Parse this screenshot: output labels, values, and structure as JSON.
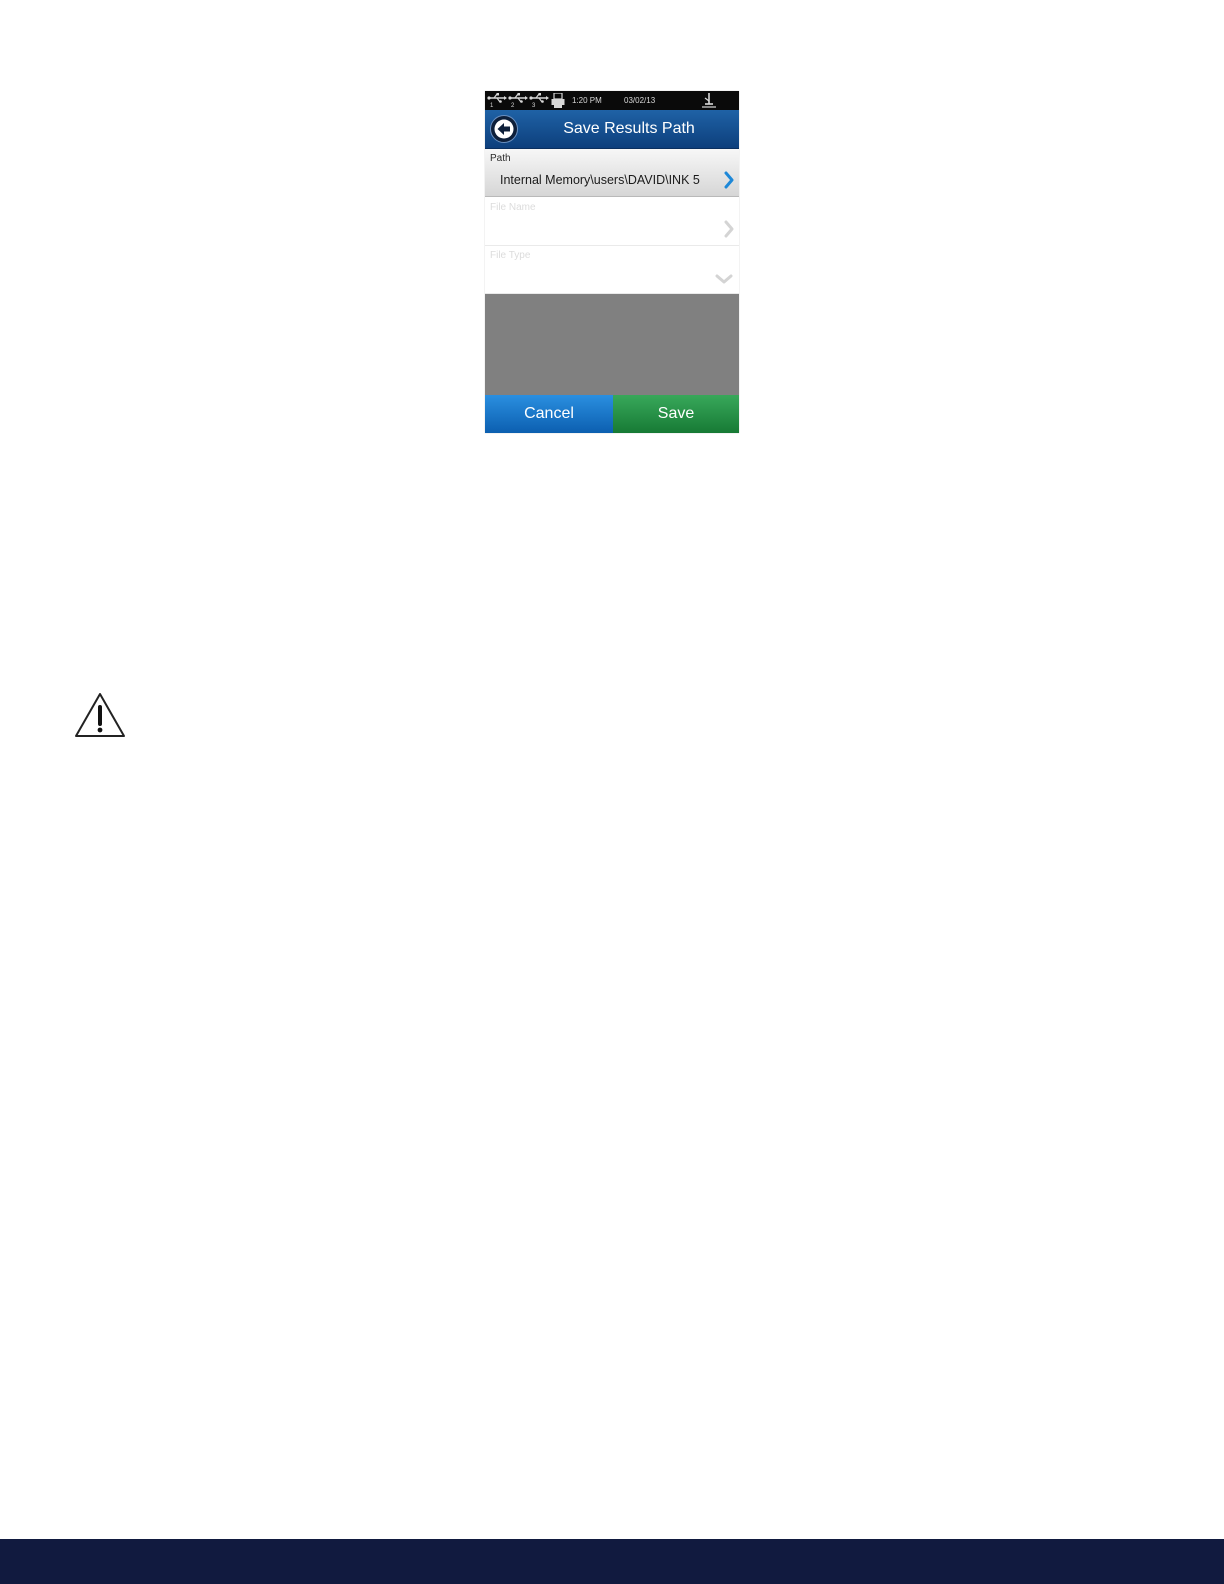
{
  "status_bar": {
    "usb_ports": [
      "1",
      "2",
      "3"
    ],
    "time": "1:20 PM",
    "date": "03/02/13",
    "icons": [
      "usb-icon",
      "printer-icon",
      "network-icon"
    ]
  },
  "header": {
    "title": "Save Results Path",
    "back_icon": "back-arrow-icon"
  },
  "fields": {
    "path": {
      "label": "Path",
      "value": "Internal Memory\\users\\DAVID\\INK 5"
    },
    "file_name": {
      "label": "File Name"
    },
    "file_type": {
      "label": "File Type"
    }
  },
  "buttons": {
    "cancel_label": "Cancel",
    "save_label": "Save"
  },
  "colors": {
    "title_bar": "#1a5a9e",
    "cancel": "#1c78cc",
    "save": "#279348",
    "empty_area": "#808080",
    "chevron_active": "#1e88d8",
    "footer": "#111a3f"
  },
  "page_icons": [
    "warning-icon"
  ]
}
